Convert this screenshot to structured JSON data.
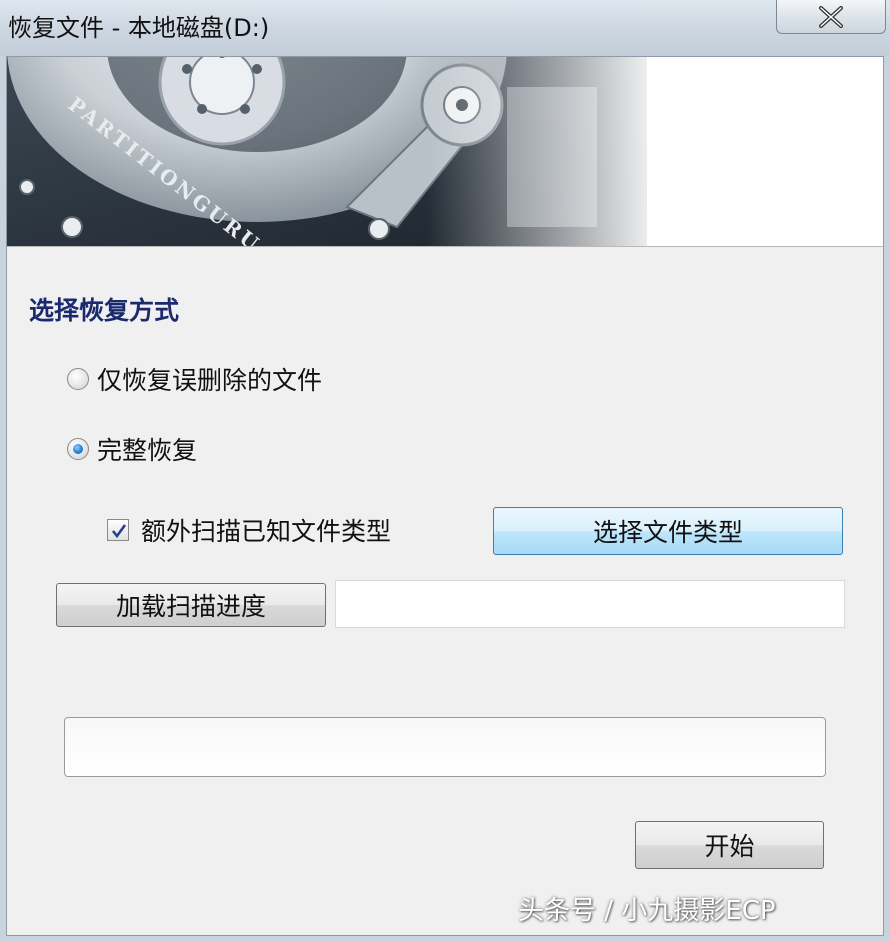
{
  "window": {
    "title": "恢复文件 - 本地磁盘(D:)",
    "close_icon": "close-icon"
  },
  "banner": {
    "brand_text": "PARTITIONGURU",
    "image": "hard-disk-illustration"
  },
  "recovery": {
    "section_title": "选择恢复方式",
    "option_deleted_only": "仅恢复误删除的文件",
    "option_full": "完整恢复",
    "selected_option": "完整恢复",
    "extra_scan_label": "额外扫描已知文件类型",
    "extra_scan_checked": true,
    "select_types_button": "选择文件类型",
    "load_progress_button": "加载扫描进度",
    "load_progress_value": "",
    "status_value": "",
    "start_button": "开始"
  },
  "watermark": "头条号 / 小九摄影ECP",
  "colors": {
    "section_title": "#1b2a6e",
    "dialog_bg": "#f0f0f0",
    "accent_button": "#bee6fd"
  }
}
